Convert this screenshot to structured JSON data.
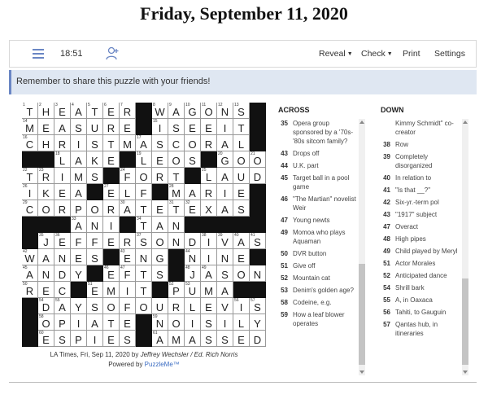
{
  "page_title": "Friday, September 11, 2020",
  "toolbar": {
    "timer": "18:51",
    "reveal": "Reveal",
    "check": "Check",
    "print": "Print",
    "settings": "Settings"
  },
  "banner": "Remember to share this puzzle with your friends!",
  "grid": {
    "rows": [
      "THEATER#WAGONS#",
      "MEASURE#ISEEIT#",
      "CHRISTMASCORAL#",
      "##LAKE#LEOS#GOO",
      "TRIMS#FORT#LAUD",
      "IKEA#ELF#MARIE#",
      "CORPORATETEXAS#",
      "###ANI#TAN#####",
      "#JEFFERSONDIVAS",
      "WANES#ENG#NINE#",
      "ANDY#EFTS#JASON",
      "REC#EMIT#PUMA##",
      "#DAYSOFOURLEVIS",
      "#OPIATE#NOISILY",
      "#ESPIES#AMASSED"
    ],
    "numbers": [
      [
        1,
        2,
        3,
        4,
        5,
        6,
        7,
        0,
        8,
        9,
        10,
        11,
        12,
        13,
        0
      ],
      [
        14,
        0,
        0,
        0,
        0,
        0,
        0,
        0,
        15,
        0,
        0,
        0,
        0,
        0,
        0
      ],
      [
        16,
        0,
        0,
        0,
        0,
        0,
        0,
        17,
        0,
        0,
        0,
        0,
        0,
        0,
        0
      ],
      [
        0,
        0,
        18,
        0,
        0,
        0,
        0,
        19,
        0,
        0,
        0,
        0,
        20,
        0,
        21
      ],
      [
        22,
        23,
        0,
        0,
        0,
        0,
        24,
        0,
        0,
        0,
        0,
        25,
        0,
        0,
        0
      ],
      [
        26,
        0,
        0,
        0,
        0,
        27,
        0,
        0,
        0,
        28,
        0,
        0,
        0,
        0,
        0
      ],
      [
        29,
        0,
        0,
        0,
        0,
        0,
        30,
        0,
        0,
        31,
        32,
        0,
        0,
        0,
        0
      ],
      [
        0,
        0,
        0,
        33,
        0,
        0,
        0,
        34,
        0,
        0,
        0,
        0,
        0,
        0,
        0
      ],
      [
        0,
        35,
        36,
        0,
        0,
        0,
        0,
        37,
        0,
        0,
        0,
        38,
        39,
        40,
        41
      ],
      [
        42,
        0,
        0,
        0,
        0,
        0,
        43,
        0,
        0,
        0,
        44,
        0,
        0,
        0,
        0
      ],
      [
        45,
        0,
        0,
        0,
        0,
        46,
        47,
        0,
        0,
        0,
        48,
        49,
        0,
        0,
        0
      ],
      [
        50,
        0,
        0,
        0,
        51,
        0,
        0,
        0,
        0,
        52,
        53,
        0,
        0,
        0,
        0
      ],
      [
        0,
        54,
        55,
        0,
        0,
        0,
        0,
        0,
        0,
        0,
        0,
        0,
        0,
        56,
        57
      ],
      [
        0,
        58,
        0,
        0,
        0,
        0,
        0,
        0,
        59,
        0,
        0,
        0,
        0,
        0,
        0
      ],
      [
        0,
        60,
        0,
        0,
        0,
        0,
        0,
        0,
        61,
        0,
        0,
        0,
        0,
        0,
        0
      ]
    ]
  },
  "credit": {
    "line1_prefix": "LA Times, Fri, Sep 11, 2020 by ",
    "author": "Jeffrey Wechsler / Ed. Rich Norris",
    "line2_prefix": "Powered by ",
    "powered": "PuzzleMe™"
  },
  "across": {
    "heading": "ACROSS",
    "clues": [
      {
        "num": "35",
        "text": "Opera group sponsored by a '70s-'80s sitcom family?"
      },
      {
        "num": "43",
        "text": "Drops off"
      },
      {
        "num": "44",
        "text": "U.K. part"
      },
      {
        "num": "45",
        "text": "Target ball in a pool game"
      },
      {
        "num": "46",
        "text": "\"The Martian\" novelist Weir"
      },
      {
        "num": "47",
        "text": "Young newts"
      },
      {
        "num": "49",
        "text": "Momoa who plays Aquaman"
      },
      {
        "num": "50",
        "text": "DVR button"
      },
      {
        "num": "51",
        "text": "Give off"
      },
      {
        "num": "52",
        "text": "Mountain cat"
      },
      {
        "num": "53",
        "text": "Denim's golden age?"
      },
      {
        "num": "58",
        "text": "Codeine, e.g."
      },
      {
        "num": "59",
        "text": "How a leaf blower operates"
      }
    ]
  },
  "down": {
    "heading": "DOWN",
    "clues": [
      {
        "num": "",
        "text": "Kimmy Schmidt\" co-creator"
      },
      {
        "num": "38",
        "text": "Row"
      },
      {
        "num": "39",
        "text": "Completely disorganized"
      },
      {
        "num": "40",
        "text": "In relation to"
      },
      {
        "num": "41",
        "text": "\"Is that __?\""
      },
      {
        "num": "42",
        "text": "Six-yr.-term pol"
      },
      {
        "num": "43",
        "text": "\"1917\" subject"
      },
      {
        "num": "47",
        "text": "Overact"
      },
      {
        "num": "48",
        "text": "High pipes"
      },
      {
        "num": "49",
        "text": "Child played by Meryl"
      },
      {
        "num": "51",
        "text": "Actor Morales"
      },
      {
        "num": "52",
        "text": "Anticipated dance"
      },
      {
        "num": "54",
        "text": "Shrill bark"
      },
      {
        "num": "55",
        "text": "A, in Oaxaca"
      },
      {
        "num": "56",
        "text": "Tahiti, to Gauguin"
      },
      {
        "num": "57",
        "text": "Qantas hub, in itineraries"
      }
    ]
  },
  "icons": {
    "menu": "hamburger-menu-icon",
    "add_person": "add-person-icon"
  },
  "colors": {
    "accent": "#6a86c4",
    "banner_bg": "#dfe7f2",
    "block": "#111111"
  }
}
